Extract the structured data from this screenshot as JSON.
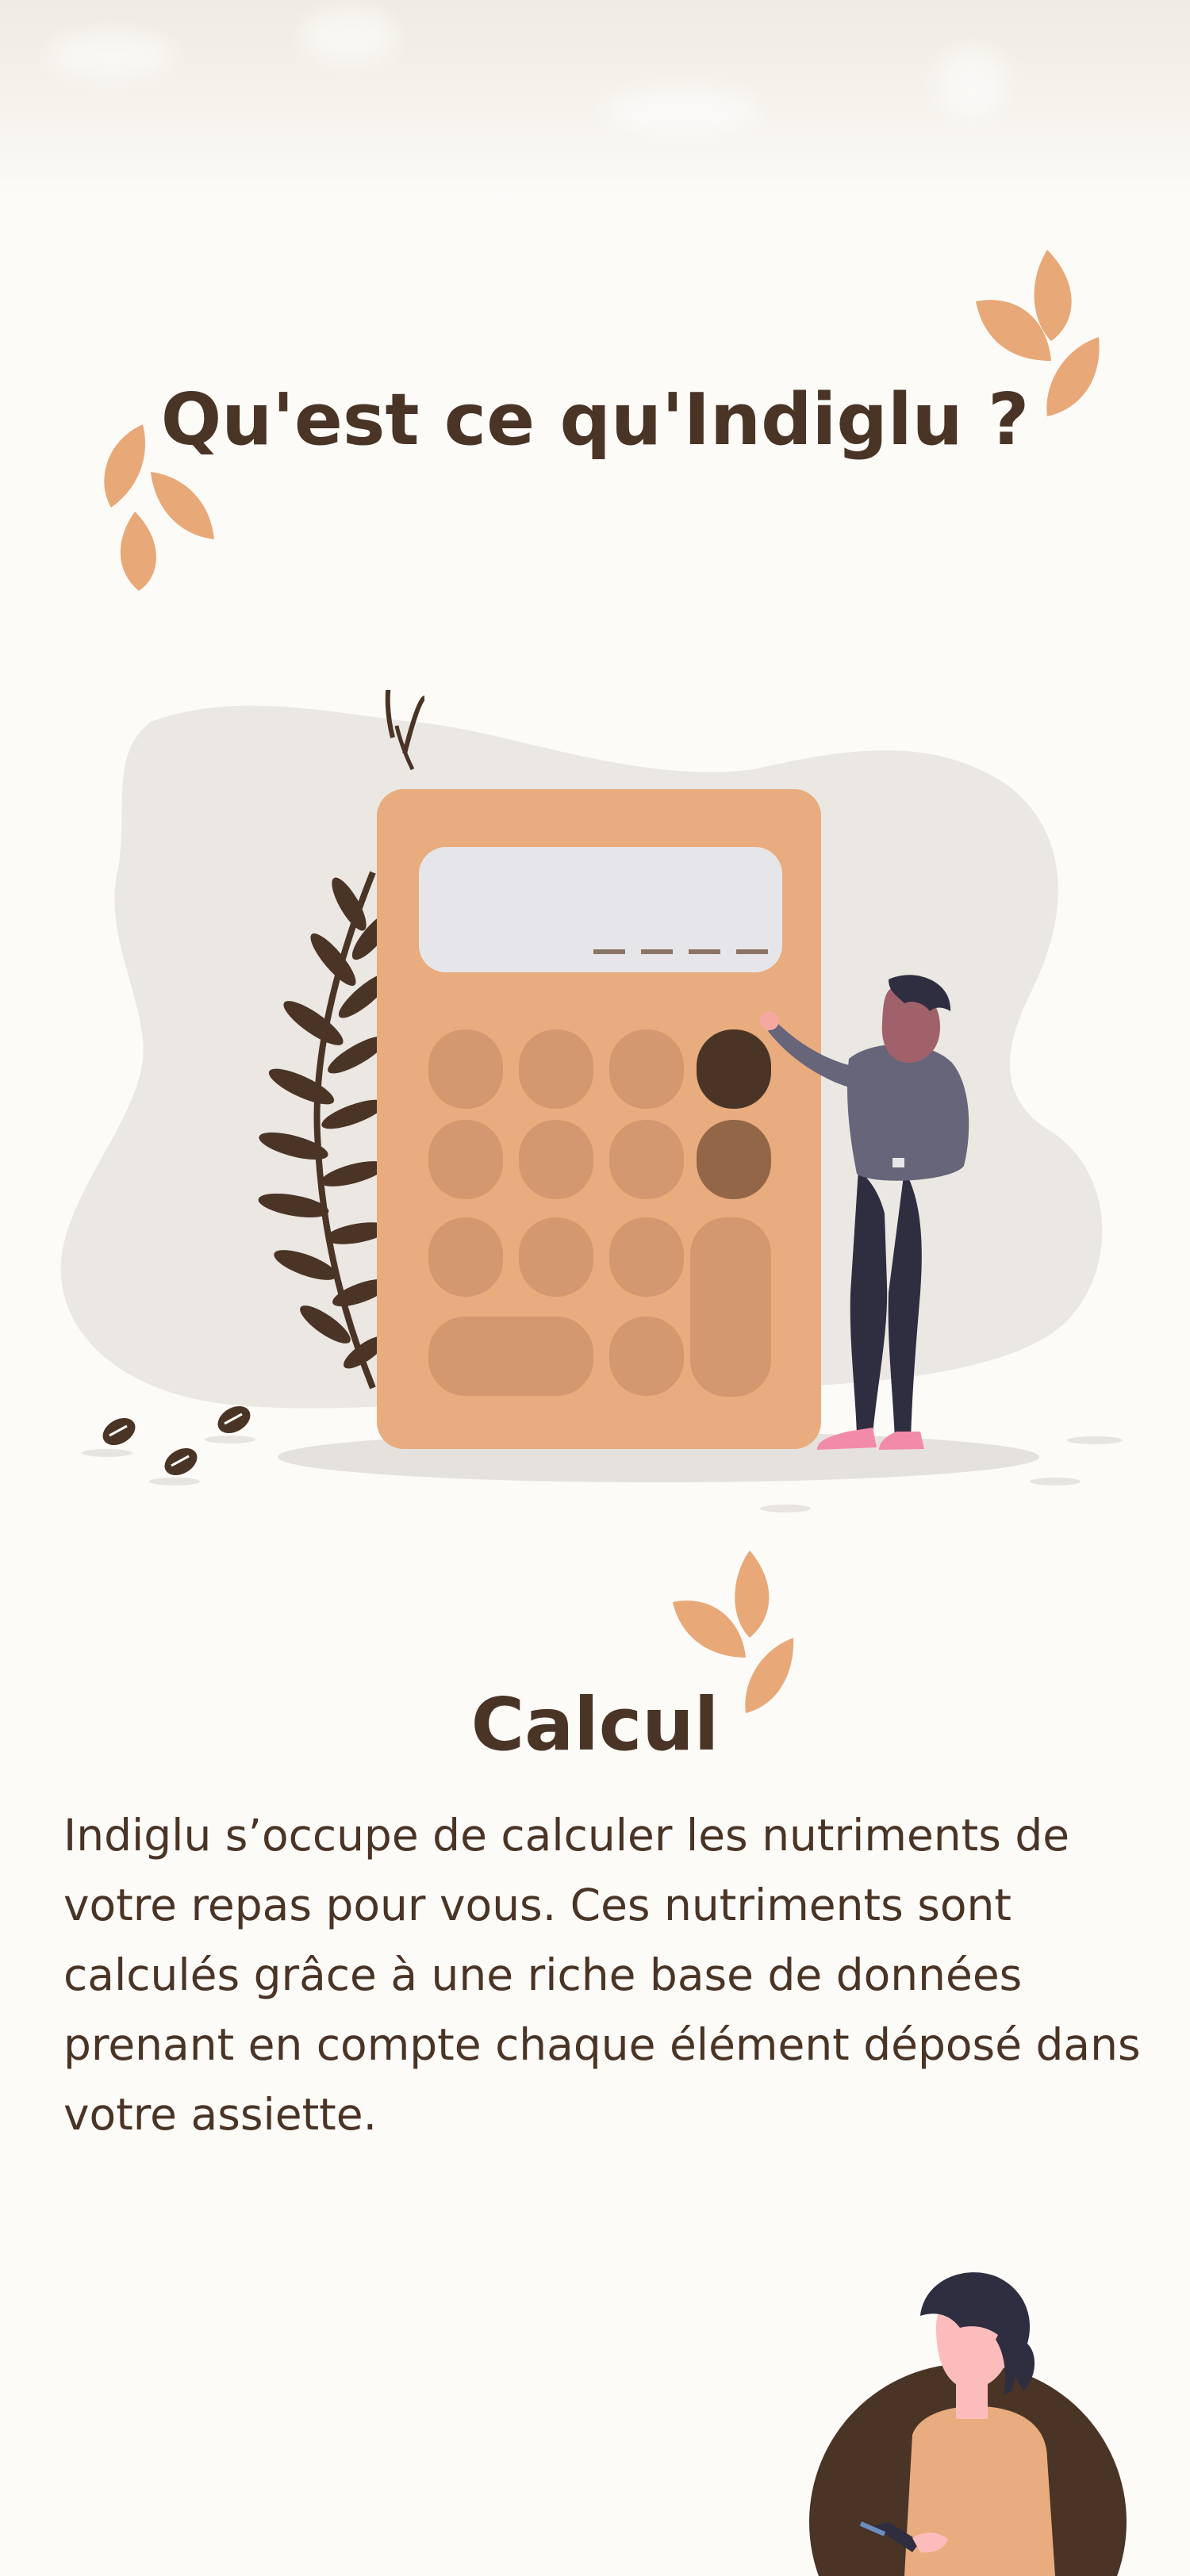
{
  "hero": {
    "title": "Qu'est ce qu'Indiglu ?"
  },
  "calculator": {
    "display_dashes": "_ _ _ _"
  },
  "section_calcul": {
    "title": "Calcul",
    "text": "Indiglu s’occupe de calculer les nutriments de votre repas pour vous. Ces nutriments sont calculés grâce à une riche base de données prenant en compte chaque élément déposé dans votre assiette."
  },
  "colors": {
    "background": "#fcfbf8",
    "primary_text": "#4a3426",
    "accent_leaf": "#e8a878",
    "calculator_body": "#e8ac7e",
    "calculator_key": "#d49870",
    "calculator_key_dark": "#4a3426",
    "calculator_key_medium": "#936648",
    "blob": "#ebe7e2",
    "person_shirt": "#66657a",
    "person_pants": "#2f2e41"
  },
  "icons": {
    "leaf": "leaf-cluster-icon",
    "seed": "seed-icon",
    "plant": "fern-plant-icon"
  }
}
